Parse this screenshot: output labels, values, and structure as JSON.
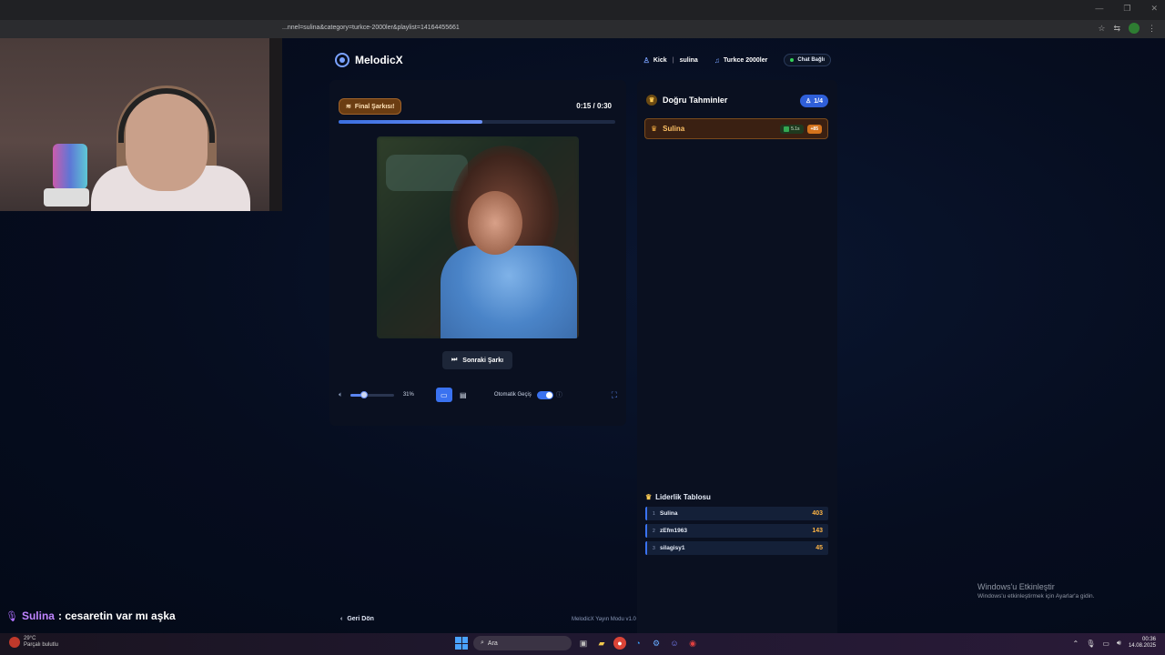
{
  "browser": {
    "url": "...nnel=sulina&category=turkce-2000ler&playlist=14164455661",
    "window_controls": [
      "—",
      "❐",
      "✕"
    ]
  },
  "header": {
    "logo_text": "MelodicX",
    "platform": "Kick",
    "channel": "sulina",
    "category": "Turkce 2000ler",
    "chat_status": "Chat Bağlı"
  },
  "player": {
    "final_badge": "Final Şarkısı!",
    "time": "0:15 / 0:30",
    "progress": 0.52,
    "next_button": "Sonraki Şarkı",
    "volume_percent": "31%",
    "volume": 0.31,
    "auto_label": "Otomatik Geçiş",
    "auto_on": true
  },
  "guesses": {
    "title": "Doğru Tahminler",
    "count": "1/4",
    "items": [
      {
        "name": "Sulina",
        "time": "5.1s",
        "points": "+85"
      }
    ]
  },
  "leaderboard": {
    "title": "Liderlik Tablosu",
    "rows": [
      {
        "rank": "1",
        "name": "Sulina",
        "score": "403"
      },
      {
        "rank": "2",
        "name": "zEfm1963",
        "score": "143"
      },
      {
        "rank": "3",
        "name": "silagisy1",
        "score": "45"
      }
    ]
  },
  "footer": {
    "back": "Geri Dön",
    "version": "MelodicX Yayın Modu v1.0"
  },
  "windows_activation": {
    "title": "Windows'u Etkinleştir",
    "subtitle": "Windows'u etkinleştirmek için Ayarlar'a gidin."
  },
  "chat_overlay": {
    "user": "Sulina",
    "message": ": cesaretin var mı aşka"
  },
  "taskbar": {
    "weather_line1": "29°C",
    "weather_line2": "Parçalı bulutlu",
    "search_placeholder": "Ara",
    "time": "00:36",
    "date": "14.08.2025"
  },
  "colors": {
    "accent": "#3a72f0",
    "gold": "#ffb545",
    "chat_user": "#c084ff"
  }
}
